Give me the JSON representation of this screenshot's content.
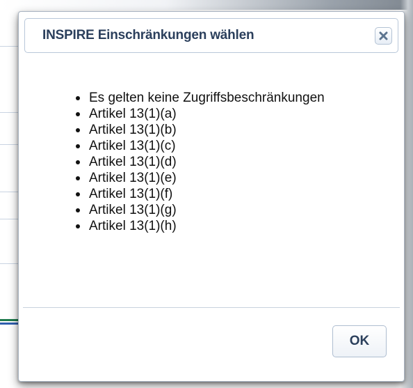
{
  "dialog": {
    "title": "INSPIRE Einschränkungen wählen",
    "close_icon": "close-icon",
    "options": [
      "Es gelten keine Zugriffsbeschränkungen",
      "Artikel 13(1)(a)",
      "Artikel 13(1)(b)",
      "Artikel 13(1)(c)",
      "Artikel 13(1)(d)",
      "Artikel 13(1)(e)",
      "Artikel 13(1)(f)",
      "Artikel 13(1)(g)",
      "Artikel 13(1)(h)"
    ],
    "ok_label": "OK"
  },
  "colors": {
    "title_text": "#2b3f5c",
    "border": "#a9b4c2",
    "accent_green": "#1f7a4d",
    "accent_blue": "#2f5fae"
  }
}
